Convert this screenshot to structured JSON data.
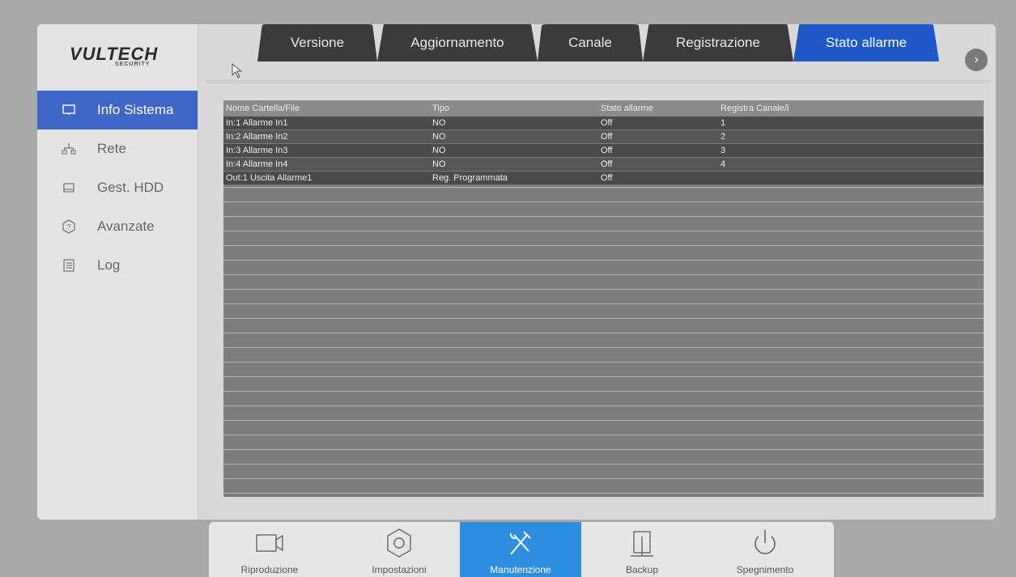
{
  "logo": {
    "text": "VULTECH",
    "sub": "SECURITY"
  },
  "sidebar": {
    "items": [
      {
        "label": "Info Sistema",
        "icon": "monitor-icon",
        "active": true
      },
      {
        "label": "Rete",
        "icon": "network-icon",
        "active": false
      },
      {
        "label": "Gest. HDD",
        "icon": "hdd-icon",
        "active": false
      },
      {
        "label": "Avanzate",
        "icon": "settings-advanced-icon",
        "active": false
      },
      {
        "label": "Log",
        "icon": "log-icon",
        "active": false
      }
    ]
  },
  "tabs": [
    {
      "label": "Versione",
      "active": false
    },
    {
      "label": "Aggiornamento",
      "active": false
    },
    {
      "label": "Canale",
      "active": false
    },
    {
      "label": "Registrazione",
      "active": false
    },
    {
      "label": "Stato allarme",
      "active": true
    }
  ],
  "tab_next_icon": "chevron-right-icon",
  "table": {
    "headers": [
      "Nome Cartella/File",
      "Tipo",
      "Stato allarme",
      "Registra Canale/i"
    ],
    "rows": [
      [
        "In:1 Allarme In1",
        "NO",
        "Off",
        "1"
      ],
      [
        "In:2 Allarme In2",
        "NO",
        "Off",
        "2"
      ],
      [
        "In:3 Allarme In3",
        "NO",
        "Off",
        "3"
      ],
      [
        "In:4 Allarme In4",
        "NO",
        "Off",
        "4"
      ],
      [
        "Out:1 Uscita Allarme1",
        "Reg. Programmata",
        "Off",
        ""
      ]
    ]
  },
  "dock": {
    "items": [
      {
        "label": "Riproduzione",
        "icon": "camera-icon",
        "active": false
      },
      {
        "label": "Impostazioni",
        "icon": "gear-icon",
        "active": false
      },
      {
        "label": "Manutenzione",
        "icon": "tools-icon",
        "active": true
      },
      {
        "label": "Backup",
        "icon": "backup-icon",
        "active": false
      },
      {
        "label": "Spegnimento",
        "icon": "power-icon",
        "active": false
      }
    ]
  },
  "colors": {
    "accent": "#1f57c8",
    "sidebar_active": "#3d66c7",
    "dock_active": "#2d8ee0"
  }
}
